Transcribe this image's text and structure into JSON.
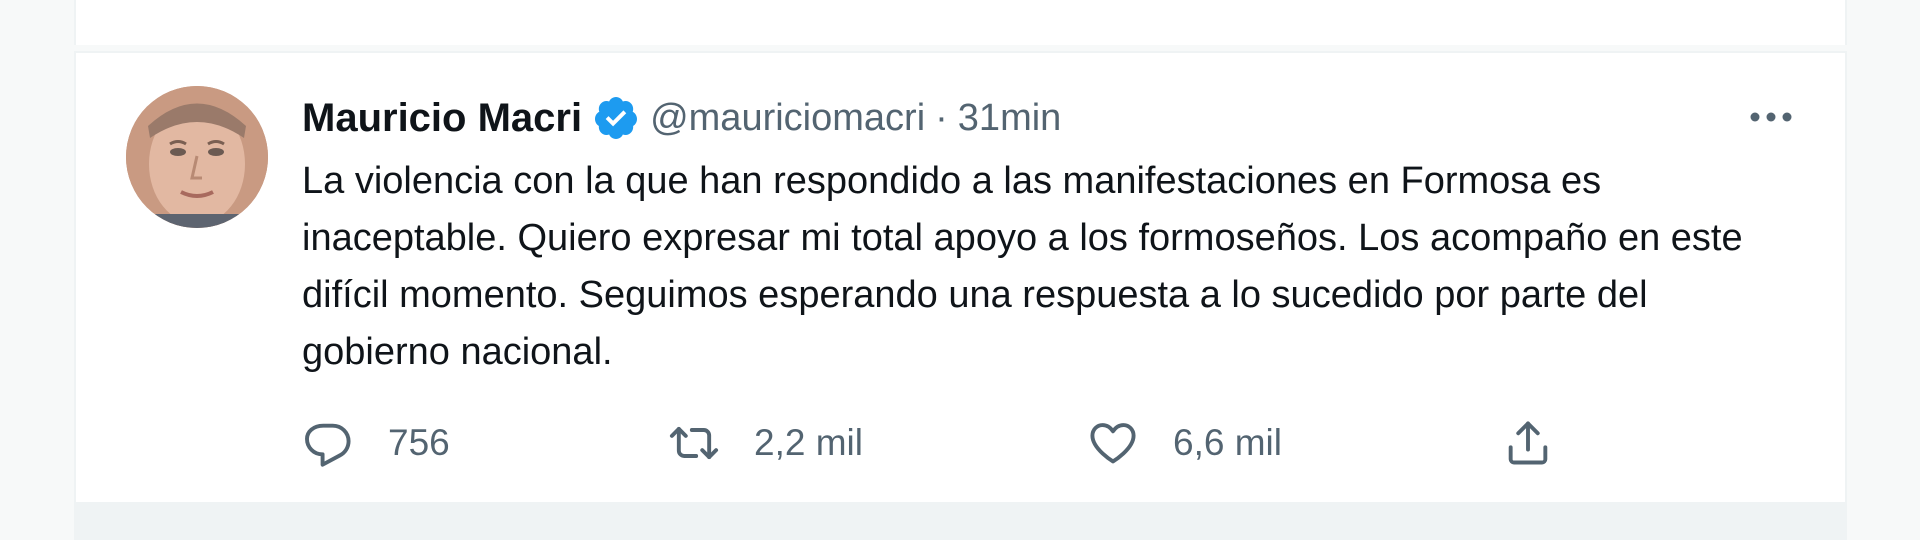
{
  "tweet": {
    "author_name": "Mauricio Macri",
    "handle": "@mauriciomacri",
    "separator": "·",
    "time": "31min",
    "text": "La violencia con la que han respondido a las manifestaciones en Formosa es inaceptable. Quiero expresar mi total apoyo a los formoseños. Los acompaño en este difícil momento. Seguimos esperando una respuesta a lo sucedido por parte del gobierno nacional.",
    "replies": "756",
    "retweets": "2,2 mil",
    "likes": "6,6 mil"
  },
  "icons": {
    "verified": "verified-badge-icon",
    "more": "more-options-icon",
    "reply": "reply-icon",
    "retweet": "retweet-icon",
    "like": "like-icon",
    "share": "share-icon"
  },
  "colors": {
    "verified_blue": "#1d9bf0",
    "text": "#0f1419",
    "secondary": "#536471",
    "border": "#eff3f4",
    "background": "#f7f9f9"
  }
}
